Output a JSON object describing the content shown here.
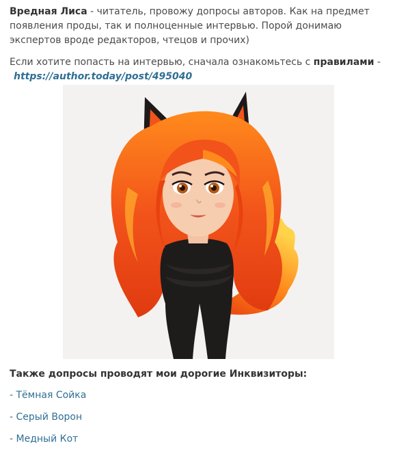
{
  "intro": {
    "name": "Вредная Лиса",
    "text": " - читатель, провожу допросы авторов. Как на предмет появления проды, так и полноценные интервью. Порой донимаю экспертов вроде редакторов, чтецов и прочих)"
  },
  "rules": {
    "text_before": "Если хотите попасть на интервью, сначала ознакомьтесь с ",
    "rules_word": "правилами",
    "dash": " -",
    "link": "https://author.today/post/495040"
  },
  "image": {
    "icon": "fox-girl-illustration",
    "colors": {
      "hair": "#f25a12",
      "hair_light": "#ffa21f",
      "outfit": "#1e1b1b",
      "skin": "#f7cdb0",
      "background": "#f4f2f0"
    }
  },
  "inquisitors": {
    "heading": "Также допросы проводят мои дорогие Инквизиторы:",
    "items": [
      {
        "label": "- Тёмная Сойка"
      },
      {
        "label": "- Серый Ворон"
      },
      {
        "label": "- Медный Кот"
      }
    ]
  }
}
